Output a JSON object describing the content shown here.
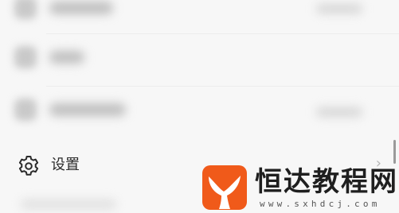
{
  "settings": {
    "label": "设置",
    "icon": "gear-icon",
    "chevron": "›"
  },
  "watermark": {
    "logo": "whale-tail-logo",
    "title": "恒达教程网",
    "url": "www.sxhdcj.com",
    "brand_color": "#f05a1a"
  },
  "colors": {
    "background": "#f7f7f7",
    "text": "#2b2b2b"
  }
}
